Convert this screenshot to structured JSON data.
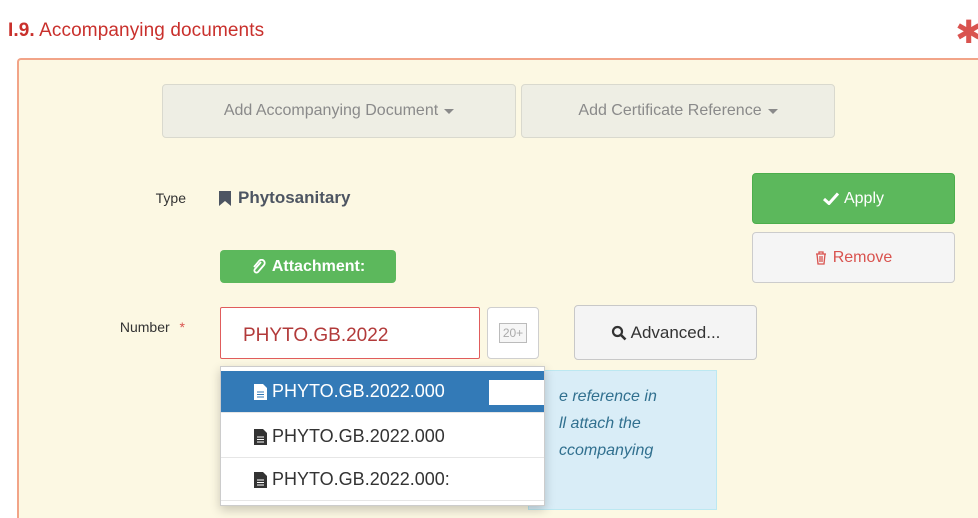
{
  "section": {
    "number": "I.9.",
    "title": " Accompanying documents",
    "required_mark": "✱"
  },
  "toolbar": {
    "add_document_label": "Add Accompanying Document",
    "add_certificate_label": "Add Certificate Reference"
  },
  "form": {
    "type_label": "Type",
    "type_value": "Phytosanitary",
    "attachment_label": "Attachment:",
    "number_label": "Number",
    "number_required_mark": "*",
    "number_value": "PHYTO.GB.2022",
    "counter_badge": "20+",
    "advanced_label": "Advanced..."
  },
  "actions": {
    "apply_label": "Apply",
    "remove_label": "Remove"
  },
  "autocomplete": {
    "items": [
      {
        "label": "PHYTO.GB.2022.000",
        "active": true
      },
      {
        "label": "PHYTO.GB.2022.000",
        "active": false
      },
      {
        "label": "PHYTO.GB.2022.000:",
        "active": false
      }
    ]
  },
  "info": {
    "line1": "e reference in",
    "line2": "ll attach the",
    "line3": "ccompanying"
  },
  "colors": {
    "accent_red": "#c9302c",
    "success_green": "#5cb85c",
    "panel_bg": "#fcf8e3",
    "active_blue": "#337ab7"
  }
}
